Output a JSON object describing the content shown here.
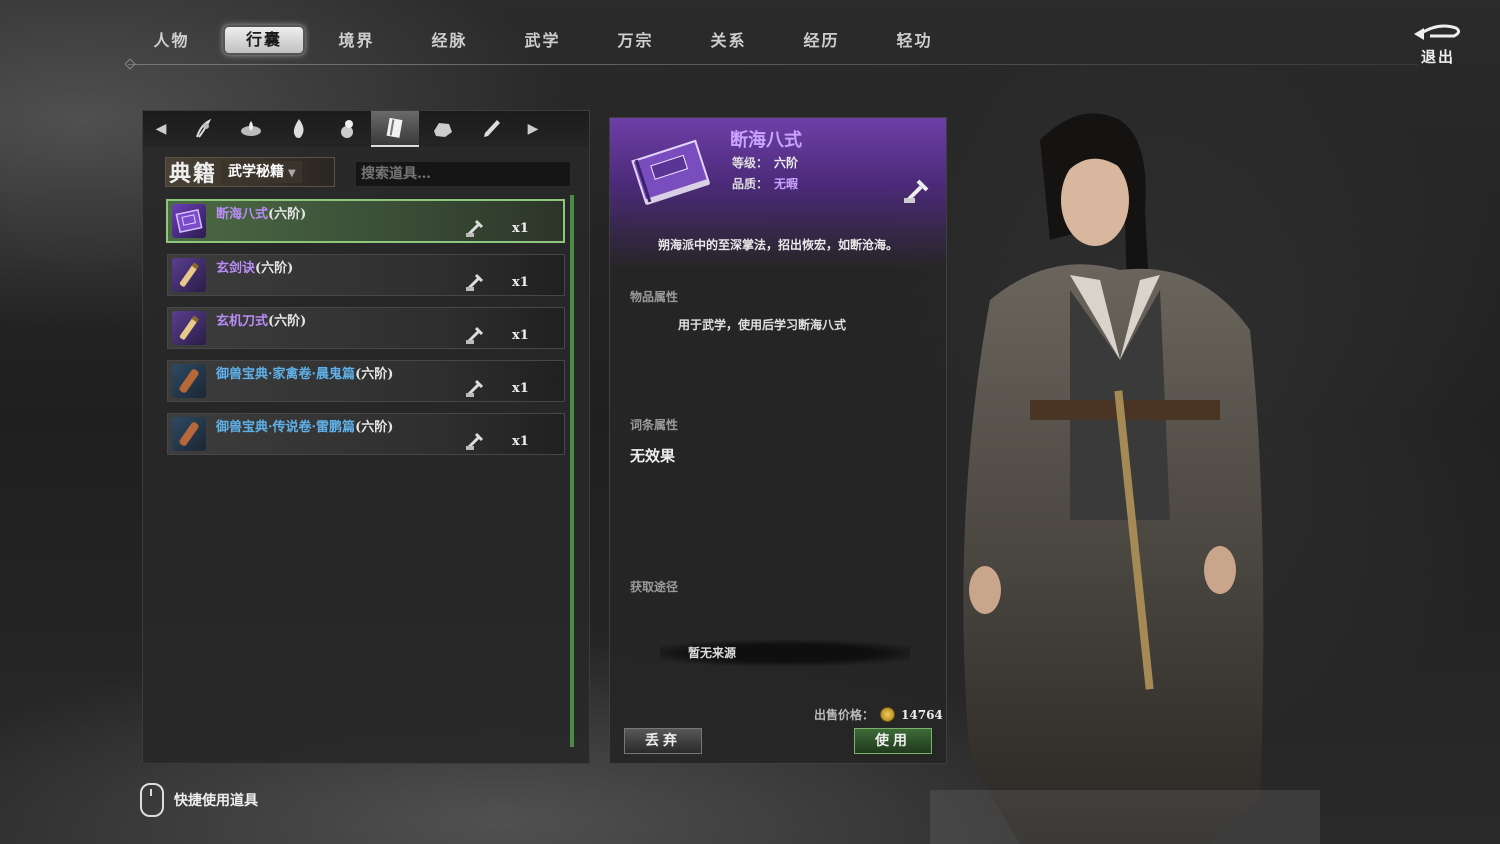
{
  "top_tabs": [
    "人物",
    "行囊",
    "境界",
    "经脉",
    "武学",
    "万宗",
    "关系",
    "经历",
    "轻功"
  ],
  "active_tab": "行囊",
  "exit_label": "退出",
  "category_icons": [
    "herb-icon",
    "lotus-icon",
    "flame-icon",
    "gourd-icon",
    "book-icon",
    "ore-icon",
    "brush-icon"
  ],
  "filter": {
    "main": "典籍",
    "sub": "武学秘籍"
  },
  "search_placeholder": "搜索道具…",
  "items": [
    {
      "name": "断海八式",
      "suffix": "(六阶)",
      "qty": "x1",
      "color": "#b88cf5",
      "icon": "martial-book-icon"
    },
    {
      "name": "玄剑诀",
      "suffix": "(六阶)",
      "qty": "x1",
      "color": "#b88cf5",
      "icon": "scroll-icon"
    },
    {
      "name": "玄机刀式",
      "suffix": "(六阶)",
      "qty": "x1",
      "color": "#b88cf5",
      "icon": "scroll-icon"
    },
    {
      "name": "御兽宝典·家禽卷·晨鬼篇",
      "suffix": "(六阶)",
      "qty": "x1",
      "color": "#5fb0e8",
      "icon": "scroll-icon"
    },
    {
      "name": "御兽宝典·传说卷·雷鹏篇",
      "suffix": "(六阶)",
      "qty": "x1",
      "color": "#5fb0e8",
      "icon": "scroll-icon"
    }
  ],
  "hint": "快捷使用道具",
  "detail": {
    "title": "断海八式",
    "grade_label": "等级：",
    "grade_value": "六阶",
    "quality_label": "品质：",
    "quality_value": "无暇",
    "description": "朔海派中的至深掌法，招出恢宏，如断沧海。",
    "attr_label": "物品属性",
    "attr_value": "用于武学，使用后学习断海八式",
    "entry_label": "词条属性",
    "entry_value": "无效果",
    "source_label": "获取途径",
    "source_value": "暂无来源",
    "price_label": "出售价格：",
    "price_value": "14764",
    "discard_label": "丢弃",
    "use_label": "使用"
  },
  "colors": {
    "purple": "#b88cf5",
    "blue": "#5fb0e8",
    "select_green": "#8fc67e"
  }
}
